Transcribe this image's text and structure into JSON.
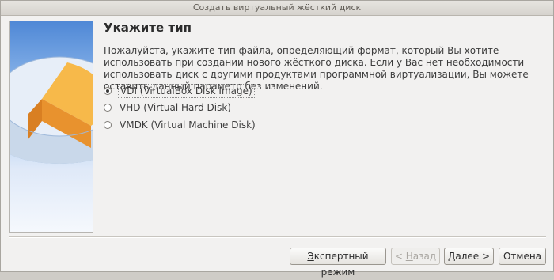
{
  "window": {
    "title": "Создать виртуальный жёсткий диск"
  },
  "page": {
    "heading": "Укажите тип",
    "description": "Пожалуйста, укажите тип файла, определяющий формат, который Вы хотите использовать при создании нового жёсткого диска. Если у Вас нет необходимости использовать диск с другими продуктами программной виртуализации, Вы можете оставить данный параметр без изменений."
  },
  "options": [
    {
      "label": "VDI (VirtualBox Disk Image)",
      "selected": true
    },
    {
      "label": "VHD (Virtual Hard Disk)",
      "selected": false
    },
    {
      "label": "VMDK (Virtual Machine Disk)",
      "selected": false
    }
  ],
  "buttons": {
    "expert": {
      "mn": "Э",
      "rest": "кспертный режим"
    },
    "back": {
      "pre": "< ",
      "mn": "Н",
      "rest": "азад"
    },
    "next": {
      "mn": "Д",
      "rest": "алее >"
    },
    "cancel": "Отмена"
  },
  "colors": {
    "disk_top": "#f7b94a",
    "disk_side": "#e8922e",
    "disk_body": "#c9d8ea",
    "side_bg_top": "#4f88d6"
  },
  "icons": {
    "side_image": "hard-disk-pie-icon"
  }
}
